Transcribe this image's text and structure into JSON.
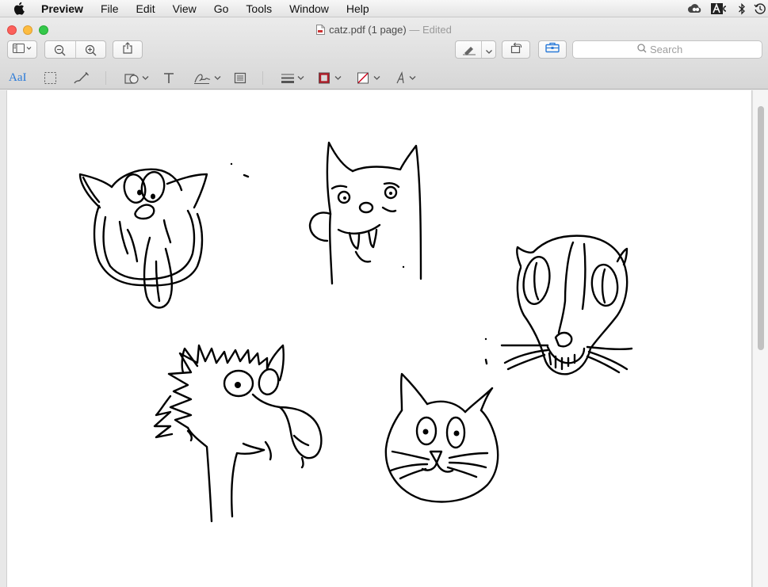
{
  "menubar": {
    "apple_icon": "apple-icon",
    "items": [
      "Preview",
      "File",
      "Edit",
      "View",
      "Go",
      "Tools",
      "Window",
      "Help"
    ],
    "status_icons": [
      "creative-cloud-icon",
      "adobe-icon",
      "bluetooth-icon",
      "time-machine-icon"
    ]
  },
  "window": {
    "filename": "catz.pdf (1 page)",
    "separator": "—",
    "status": "Edited",
    "search_placeholder": "Search"
  },
  "toolbar": {
    "icons": [
      "sidebar-icon",
      "zoom-out-icon",
      "zoom-in-icon",
      "share-icon",
      "markup-pen-icon",
      "rotate-icon",
      "toolbox-icon"
    ]
  },
  "markup": {
    "text_selection_label": "AaI",
    "tools": [
      "rect-selection-icon",
      "sketch-icon",
      "shapes-icon",
      "text-icon",
      "signature-icon",
      "note-icon",
      "line-style-icon",
      "border-color-icon",
      "fill-color-icon",
      "font-icon"
    ],
    "border_color": "#b01e2a",
    "accent": "#2a7ad8"
  },
  "document": {
    "drawings": [
      "cat-tongue-out",
      "cat-tall-fanged",
      "cat-skull-whiskers",
      "cat-scruffy",
      "cat-round-simple"
    ]
  }
}
